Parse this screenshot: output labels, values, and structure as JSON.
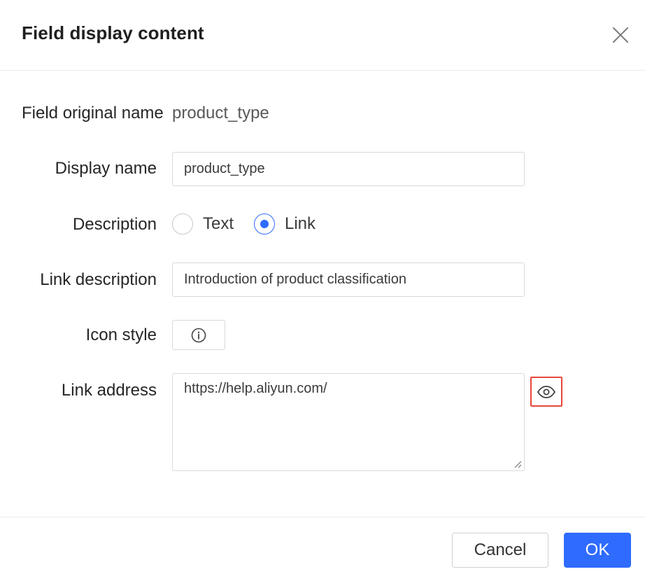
{
  "dialog": {
    "title": "Field display content",
    "close_icon": "close-icon"
  },
  "form": {
    "original_name_label": "Field original name",
    "original_name_value": "product_type",
    "display_name_label": "Display name",
    "display_name_value": "product_type",
    "description_label": "Description",
    "description_options": [
      {
        "label": "Text",
        "checked": false
      },
      {
        "label": "Link",
        "checked": true
      }
    ],
    "link_description_label": "Link description",
    "link_description_value": "Introduction of product classification",
    "icon_style_label": "Icon style",
    "icon_style_icon": "info-circle-icon",
    "link_address_label": "Link address",
    "link_address_value": "https://help.aliyun.com/",
    "preview_icon": "eye-icon",
    "accent_color": "#2f6bff",
    "highlight_color": "#e8473b"
  },
  "footer": {
    "cancel_label": "Cancel",
    "ok_label": "OK"
  }
}
